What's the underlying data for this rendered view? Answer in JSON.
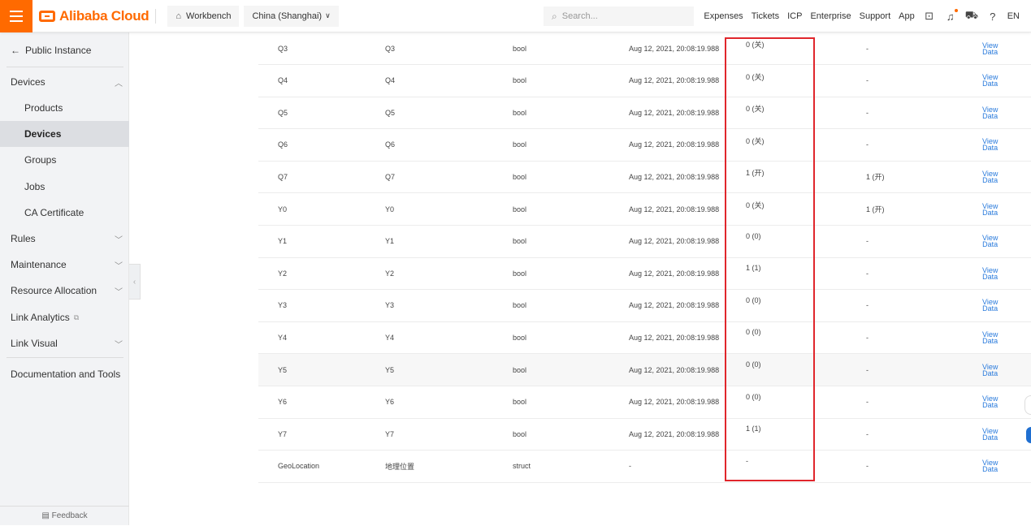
{
  "topbar": {
    "logo_text": "Alibaba Cloud",
    "workbench": "Workbench",
    "region": "China (Shanghai)",
    "search_placeholder": "Search...",
    "links": [
      "Expenses",
      "Tickets",
      "ICP",
      "Enterprise",
      "Support",
      "App"
    ],
    "lang": "EN",
    "accent": "#ff6a00"
  },
  "sidebar": {
    "back_label": "Public Instance",
    "items": [
      {
        "label": "Devices",
        "level": 1,
        "chev": "up"
      },
      {
        "label": "Products",
        "level": 2
      },
      {
        "label": "Devices",
        "level": 2,
        "active": true
      },
      {
        "label": "Groups",
        "level": 2
      },
      {
        "label": "Jobs",
        "level": 2
      },
      {
        "label": "CA Certificate",
        "level": 2
      },
      {
        "label": "Rules",
        "level": 1,
        "chev": "down"
      },
      {
        "label": "Maintenance",
        "level": 1,
        "chev": "down"
      },
      {
        "label": "Resource Allocation",
        "level": 1,
        "chev": "down"
      },
      {
        "label": "Link Analytics",
        "level": 1,
        "external": true
      },
      {
        "label": "Link Visual",
        "level": 1,
        "chev": "down"
      },
      {
        "label": "Documentation and Tools",
        "level": 1
      }
    ],
    "feedback": "Feedback"
  },
  "table": {
    "view_label_1": "View",
    "view_label_2": "Data",
    "rows": [
      {
        "id": "Q3",
        "name": "Q3",
        "type": "bool",
        "time": "Aug 12, 2021, 20:08:19.988",
        "value": "0 (关)",
        "expected": "-"
      },
      {
        "id": "Q4",
        "name": "Q4",
        "type": "bool",
        "time": "Aug 12, 2021, 20:08:19.988",
        "value": "0 (关)",
        "expected": "-"
      },
      {
        "id": "Q5",
        "name": "Q5",
        "type": "bool",
        "time": "Aug 12, 2021, 20:08:19.988",
        "value": "0 (关)",
        "expected": "-"
      },
      {
        "id": "Q6",
        "name": "Q6",
        "type": "bool",
        "time": "Aug 12, 2021, 20:08:19.988",
        "value": "0 (关)",
        "expected": "-"
      },
      {
        "id": "Q7",
        "name": "Q7",
        "type": "bool",
        "time": "Aug 12, 2021, 20:08:19.988",
        "value": "1 (开)",
        "expected": "1 (开)"
      },
      {
        "id": "Y0",
        "name": "Y0",
        "type": "bool",
        "time": "Aug 12, 2021, 20:08:19.988",
        "value": "0 (关)",
        "expected": "1 (开)"
      },
      {
        "id": "Y1",
        "name": "Y1",
        "type": "bool",
        "time": "Aug 12, 2021, 20:08:19.988",
        "value": "0 (0)",
        "expected": "-"
      },
      {
        "id": "Y2",
        "name": "Y2",
        "type": "bool",
        "time": "Aug 12, 2021, 20:08:19.988",
        "value": "1 (1)",
        "expected": "-"
      },
      {
        "id": "Y3",
        "name": "Y3",
        "type": "bool",
        "time": "Aug 12, 2021, 20:08:19.988",
        "value": "0 (0)",
        "expected": "-"
      },
      {
        "id": "Y4",
        "name": "Y4",
        "type": "bool",
        "time": "Aug 12, 2021, 20:08:19.988",
        "value": "0 (0)",
        "expected": "-"
      },
      {
        "id": "Y5",
        "name": "Y5",
        "type": "bool",
        "time": "Aug 12, 2021, 20:08:19.988",
        "value": "0 (0)",
        "expected": "-",
        "hover": true
      },
      {
        "id": "Y6",
        "name": "Y6",
        "type": "bool",
        "time": "Aug 12, 2021, 20:08:19.988",
        "value": "0 (0)",
        "expected": "-"
      },
      {
        "id": "Y7",
        "name": "Y7",
        "type": "bool",
        "time": "Aug 12, 2021, 20:08:19.988",
        "value": "1 (1)",
        "expected": "-"
      },
      {
        "id": "GeoLocation",
        "name": "地理位置",
        "type": "struct",
        "time": "-",
        "value": "-",
        "expected": "-"
      }
    ]
  },
  "colors": {
    "link": "#2a7bdc",
    "highlight": "#e0262c"
  }
}
